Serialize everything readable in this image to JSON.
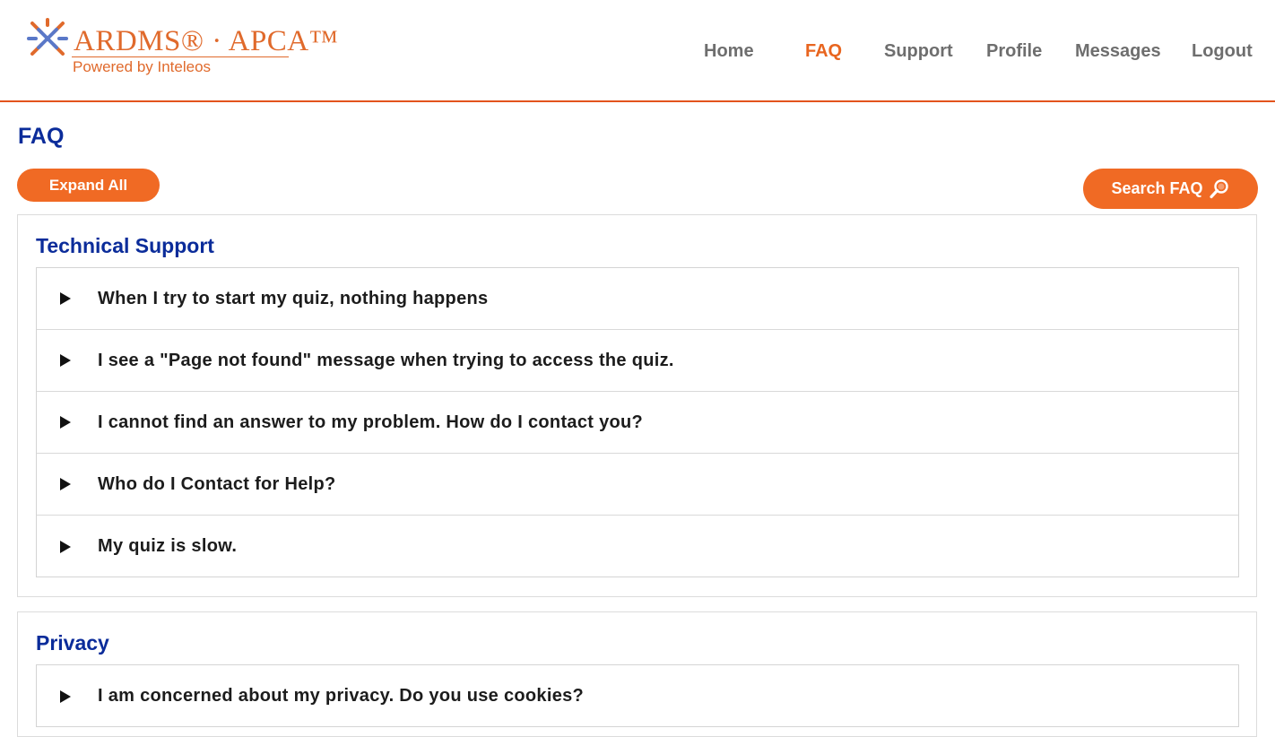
{
  "brand": {
    "logo_text": "ARDMS® · APCA™",
    "tagline": "Powered by Inteleos",
    "accent_color": "#e8651f",
    "title_color": "#0b2c9a"
  },
  "nav": {
    "items": [
      {
        "label": "Home"
      },
      {
        "label": "FAQ"
      },
      {
        "label": "Support"
      },
      {
        "label": "Profile"
      },
      {
        "label": "Messages"
      },
      {
        "label": "Logout"
      }
    ],
    "active": "FAQ"
  },
  "page": {
    "title": "FAQ",
    "expand_all_label": "Expand All",
    "search_label": "Search FAQ",
    "search_icon": "magnifier-icon"
  },
  "sections": [
    {
      "title": "Technical Support",
      "items": [
        {
          "question": "When I try to start my quiz, nothing happens"
        },
        {
          "question": "I see a \"Page not found\" message when trying to access the quiz."
        },
        {
          "question": "I cannot find an answer to my problem. How do I contact you?"
        },
        {
          "question": "Who do I Contact for Help?"
        },
        {
          "question": "My quiz is slow."
        }
      ]
    },
    {
      "title": "Privacy",
      "items": [
        {
          "question": "I am concerned about my privacy. Do you use cookies?"
        }
      ]
    }
  ]
}
